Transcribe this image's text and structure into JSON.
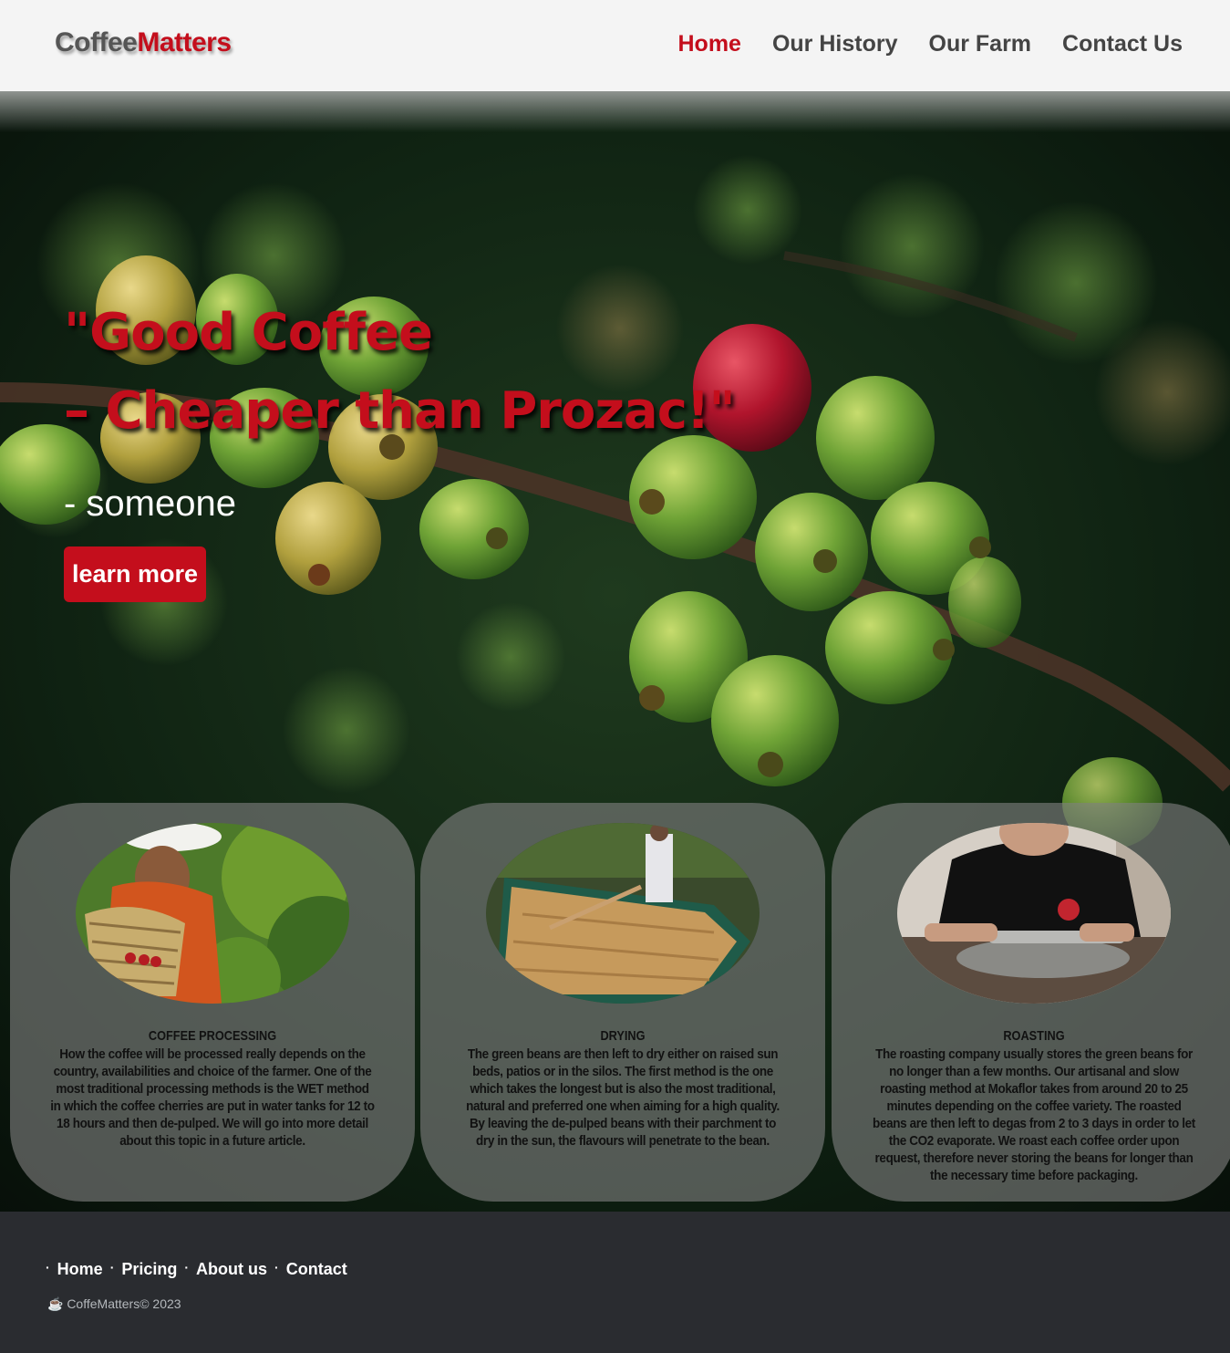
{
  "header": {
    "logo_part1": "Coffee",
    "logo_part2": "Matters",
    "nav": [
      {
        "label": "Home"
      },
      {
        "label": "Our History"
      },
      {
        "label": "Our Farm"
      },
      {
        "label": "Contact Us"
      }
    ]
  },
  "hero": {
    "quote_line1": "\"Good Coffee",
    "quote_line2": "– Cheaper than Prozac!\"",
    "author": "- someone",
    "cta_label": "learn more"
  },
  "cards": [
    {
      "title": "COFFEE PROCESSING",
      "text": "How the coffee will be processed really depends on the country, availabilities and choice of the farmer. One of the most traditional processing methods is the WET method in which the coffee cherries are put in water tanks for 12 to 18 hours and then de-pulped. We will go into more detail about this topic in a future article."
    },
    {
      "title": "DRYING",
      "text": "The green beans are then left to dry either on raised sun beds, patios or in the silos. The first method is the one which takes the longest but is also the most traditional, natural and preferred one when aiming for a high quality. By leaving the de-pulped beans with their parchment to dry in the sun, the flavours will penetrate to the bean."
    },
    {
      "title": "ROASTING",
      "text": "The roasting company usually stores the green beans for no longer than a few months. Our artisanal and slow roasting method at Mokaflor takes from around 20 to 25 minutes depending on the coffee variety. The roasted beans are then left to degas from 2 to 3 days in order to let the CO2 evaporate. We roast each coffee order upon request, therefore never storing the beans for longer than the necessary time before packaging."
    }
  ],
  "footer": {
    "links": [
      {
        "label": "Home"
      },
      {
        "label": "Pricing"
      },
      {
        "label": "About us"
      },
      {
        "label": "Contact"
      }
    ],
    "bullet": "·",
    "copyright": "☕ CoffeMatters© 2023"
  },
  "colors": {
    "accent": "#c40e1c",
    "header_bg": "#f4f4f4",
    "footer_bg": "#2a2c30"
  },
  "icons": {
    "copyright_icon": "coffee-cup-icon"
  }
}
